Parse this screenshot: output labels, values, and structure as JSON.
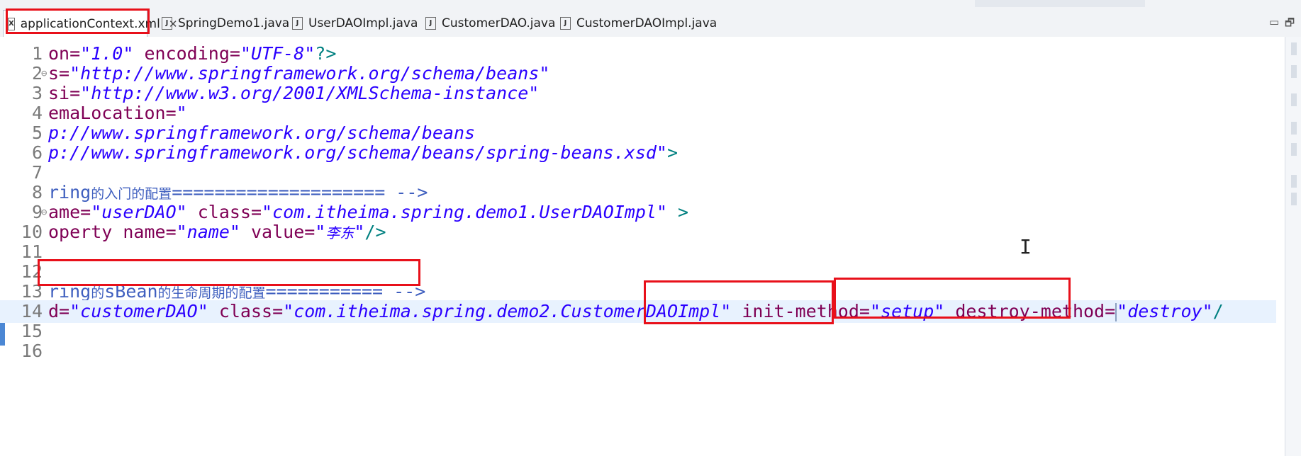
{
  "tabs": [
    {
      "label": "applicationContext.xml",
      "icon": "xml-file-icon",
      "glyph": "X",
      "active": true,
      "closable": true
    },
    {
      "label": "SpringDemo1.java",
      "icon": "java-file-icon",
      "glyph": "J"
    },
    {
      "label": "UserDAOImpl.java",
      "icon": "java-file-icon",
      "glyph": "J"
    },
    {
      "label": "CustomerDAO.java",
      "icon": "java-file-icon",
      "glyph": "J"
    },
    {
      "label": "CustomerDAOImpl.java",
      "icon": "java-file-icon",
      "glyph": "J"
    }
  ],
  "window_controls": {
    "minimize": "▭",
    "maximize": "🗗"
  },
  "editor": {
    "current_line": 14,
    "lines": [
      {
        "num": "1",
        "a1": "on=",
        "v1": "\"1.0\"",
        "a2": " encoding=",
        "v2": "\"UTF-8\"",
        "t": "?>"
      },
      {
        "num": "2",
        "fold": true,
        "a1": "s=",
        "v1": "\"http://www.springframework.org/schema/beans\""
      },
      {
        "num": "3",
        "a1": "si=",
        "v1": "\"http://www.w3.org/2001/XMLSchema-instance\""
      },
      {
        "num": "4",
        "a1": "emaLocation=",
        "v1": "\""
      },
      {
        "num": "5",
        "v1": "p://www.springframework.org/schema/beans"
      },
      {
        "num": "6",
        "v1": "p://www.springframework.org/schema/beans/spring-beans.xsd\"",
        "t": ">"
      },
      {
        "num": "7"
      },
      {
        "num": "8",
        "c1": "ring",
        "c2": "的入门的配置",
        "c3": "==================== -->"
      },
      {
        "num": "9",
        "fold": true,
        "a1": "ame=",
        "v1": "\"userDAO\"",
        "a2": " class=",
        "v2": "\"com.itheima.spring.demo1.UserDAOImpl\"",
        "t": " >"
      },
      {
        "num": "10",
        "a1": "operty name=",
        "v1": "\"name\"",
        "a2": " value=",
        "v2a": "\"",
        "v2cn": "李东",
        "v2b": "\"",
        "t": "/>"
      },
      {
        "num": "11"
      },
      {
        "num": "12"
      },
      {
        "num": "13",
        "c1": "ring",
        "c2": "的",
        "c3": "sBean",
        "c4": "的生命周期的配置",
        "c5": "=========== -->"
      },
      {
        "num": "14",
        "a1": "d=",
        "v1": "\"customerDAO\"",
        "a2": " class=",
        "v2": "\"com.itheima.spring.demo2.CustomerDAOImpl\"",
        "a3": " init-method=",
        "v3": "\"setup\"",
        "a4": " destroy-method=",
        "v4": "\"destroy\"",
        "t": "/"
      },
      {
        "num": "15"
      },
      {
        "num": "16"
      }
    ]
  },
  "pointer": "I"
}
